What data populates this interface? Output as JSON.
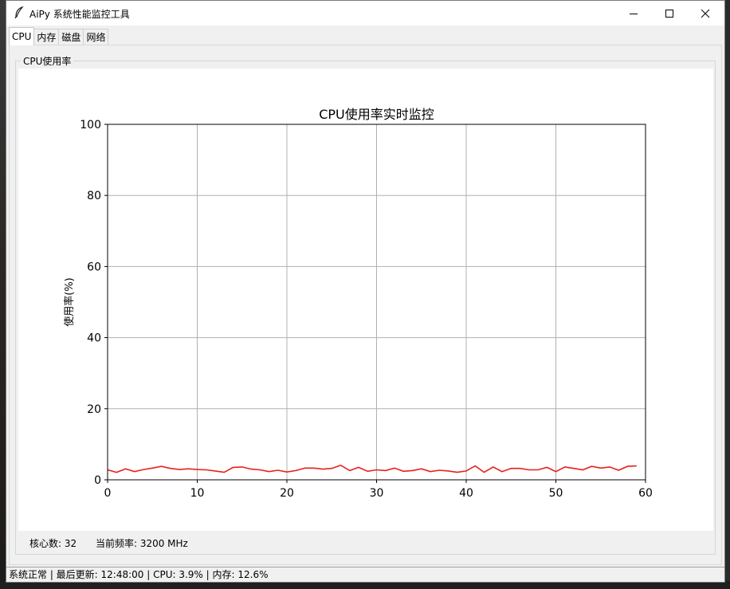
{
  "window": {
    "title": "AiPy 系统性能监控工具",
    "icon": "feather-icon",
    "controls": [
      "minimize-icon",
      "maximize-icon",
      "close-icon"
    ]
  },
  "tabs": [
    {
      "label": "CPU",
      "active": true
    },
    {
      "label": "内存",
      "active": false
    },
    {
      "label": "磁盘",
      "active": false
    },
    {
      "label": "网络",
      "active": false
    }
  ],
  "group": {
    "label": "CPU使用率"
  },
  "info": {
    "cores_label": "核心数: 32",
    "freq_label": "当前频率: 3200 MHz"
  },
  "status": {
    "text": "系统正常 | 最后更新: 12:48:00 | CPU: 3.9% | 内存: 12.6%"
  },
  "colors": {
    "line": "#e8201a",
    "grid": "#b0b0b0"
  },
  "chart_data": {
    "type": "line",
    "title": "CPU使用率实时监控",
    "xlabel": "",
    "ylabel": "使用率(%)",
    "xlim": [
      0,
      60
    ],
    "ylim": [
      0,
      100
    ],
    "xticks": [
      0,
      10,
      20,
      30,
      40,
      50,
      60
    ],
    "yticks": [
      0,
      20,
      40,
      60,
      80,
      100
    ],
    "grid": true,
    "series": [
      {
        "x": [
          0,
          1,
          2,
          3,
          4,
          5,
          6,
          7,
          8,
          9,
          10,
          11,
          12,
          13,
          14,
          15,
          16,
          17,
          18,
          19,
          20,
          21,
          22,
          23,
          24,
          25,
          26,
          27,
          28,
          29,
          30,
          31,
          32,
          33,
          34,
          35,
          36,
          37,
          38,
          39,
          40,
          41,
          42,
          43,
          44,
          45,
          46,
          47,
          48,
          49,
          50,
          51,
          52,
          53,
          54,
          55,
          56,
          57,
          58,
          59
        ],
        "values": [
          2.8,
          2.1,
          3.1,
          2.3,
          2.9,
          3.3,
          3.8,
          3.2,
          2.9,
          3.1,
          2.9,
          2.8,
          2.5,
          2.1,
          3.5,
          3.6,
          3.0,
          2.8,
          2.3,
          2.7,
          2.2,
          2.6,
          3.3,
          3.3,
          3.0,
          3.2,
          4.1,
          2.6,
          3.5,
          2.4,
          2.8,
          2.6,
          3.3,
          2.4,
          2.6,
          3.1,
          2.3,
          2.7,
          2.5,
          2.1,
          2.5,
          3.9,
          2.1,
          3.6,
          2.3,
          3.2,
          3.2,
          2.8,
          2.8,
          3.5,
          2.3,
          3.6,
          3.2,
          2.8,
          3.8,
          3.3,
          3.6,
          2.7,
          3.8,
          3.9
        ]
      }
    ]
  }
}
